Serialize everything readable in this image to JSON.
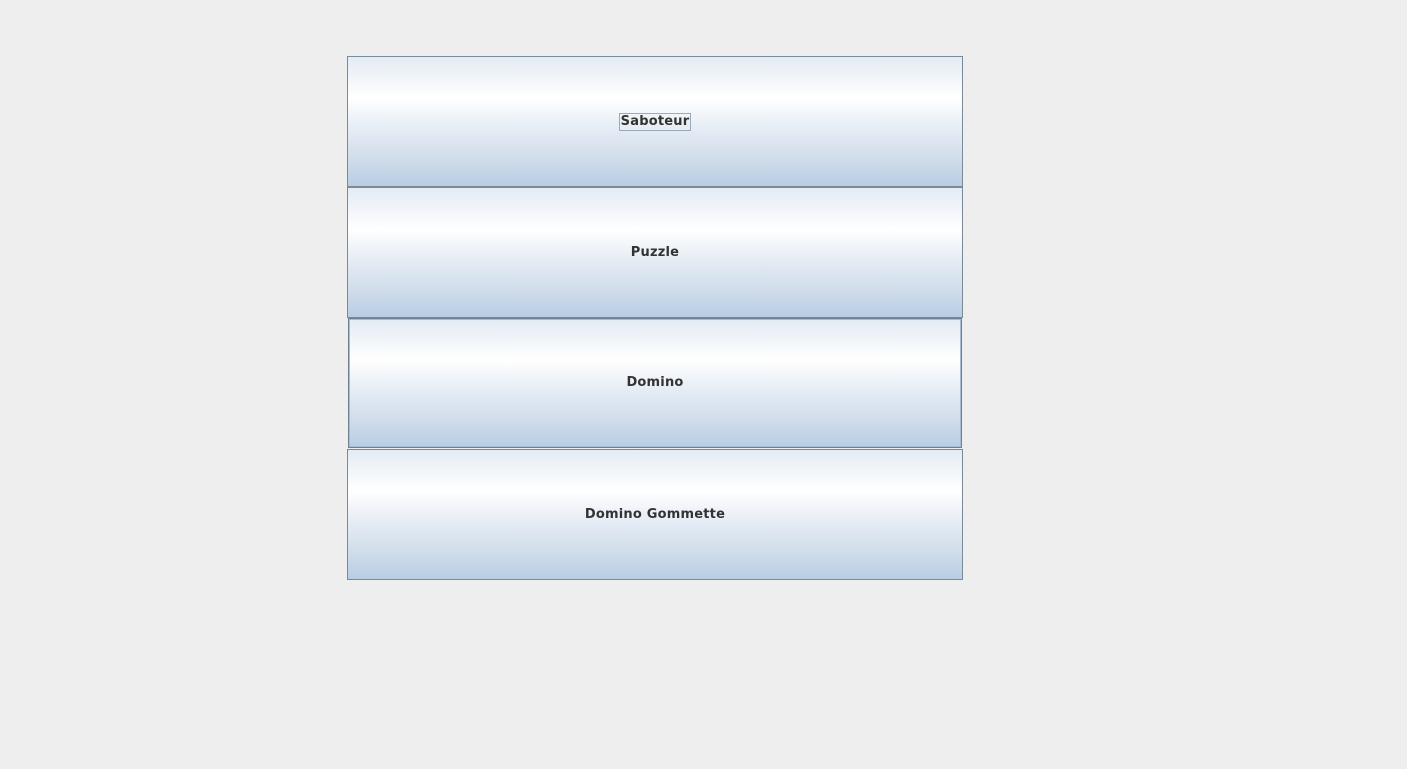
{
  "menu": {
    "buttons": [
      {
        "label": "Saboteur",
        "focused": true
      },
      {
        "label": "Puzzle",
        "focused": false
      },
      {
        "label": "Domino",
        "focused": false
      },
      {
        "label": "Domino Gommette",
        "focused": false
      }
    ]
  },
  "colors": {
    "background": "#eeeeee",
    "button_border": "#7a8a99",
    "button_gradient_top": "#e3ebf3",
    "button_gradient_highlight": "#ffffff",
    "button_gradient_bottom": "#b8cde3",
    "label_text": "#333333"
  }
}
